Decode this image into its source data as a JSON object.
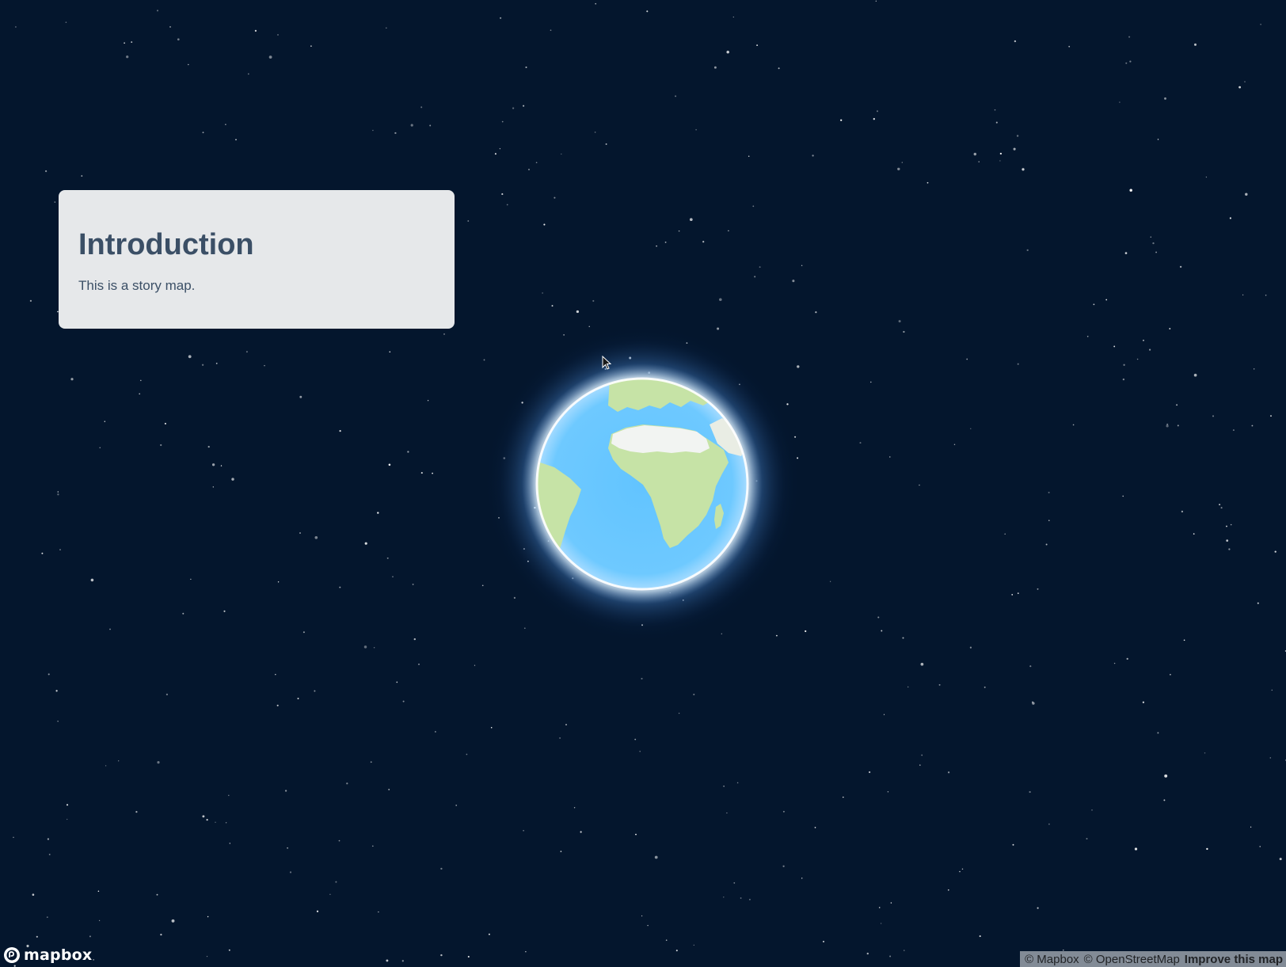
{
  "story": {
    "title": "Introduction",
    "description": "This is a story map."
  },
  "branding": {
    "logo_text": "mapbox",
    "logo_icon": "mapbox-logo-icon"
  },
  "attribution": {
    "mapbox": "© Mapbox",
    "osm": "© OpenStreetMap",
    "improve": "Improve this map"
  },
  "map": {
    "projection": "globe",
    "space_color": "#04162d",
    "ocean_color": "#6cc8ff",
    "land_color": "#c6e3a6",
    "ice_color": "#f2f4f2"
  }
}
